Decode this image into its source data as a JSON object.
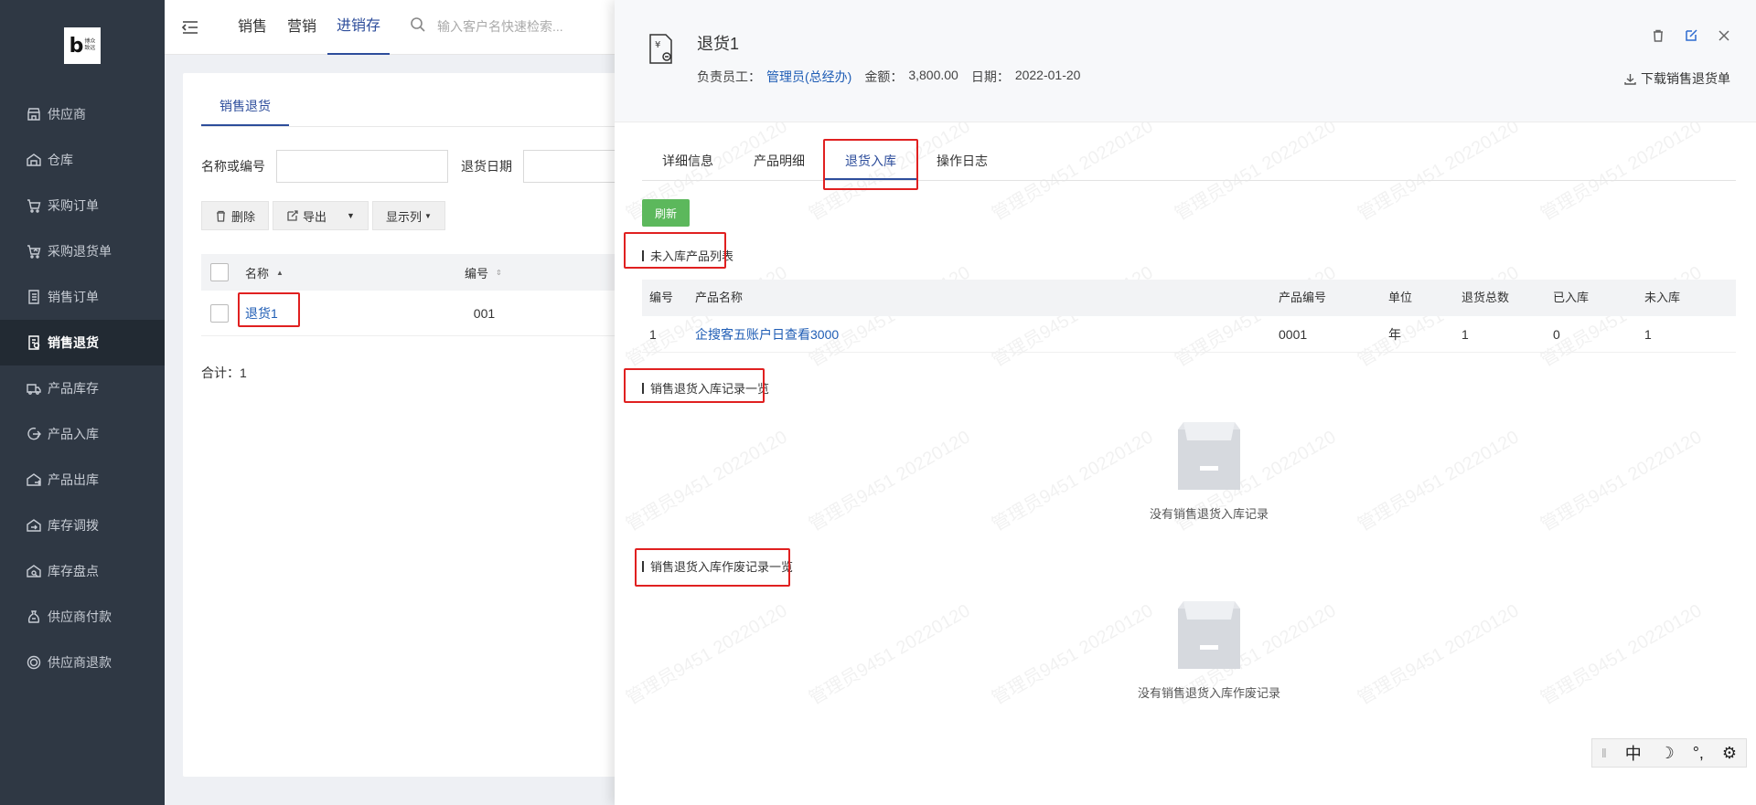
{
  "sidebar": {
    "logo": {
      "mark": "b",
      "text_line1": "博众",
      "text_line2": "致远"
    },
    "items": [
      {
        "label": "供应商",
        "icon": "store-icon",
        "active": false
      },
      {
        "label": "仓库",
        "icon": "warehouse-icon",
        "active": false
      },
      {
        "label": "采购订单",
        "icon": "cart-icon",
        "active": false
      },
      {
        "label": "采购退货单",
        "icon": "cart-return-icon",
        "active": false
      },
      {
        "label": "销售订单",
        "icon": "list-doc-icon",
        "active": false
      },
      {
        "label": "销售退货",
        "icon": "return-doc-icon",
        "active": true
      },
      {
        "label": "产品库存",
        "icon": "truck-icon",
        "active": false
      },
      {
        "label": "产品入库",
        "icon": "inbound-icon",
        "active": false
      },
      {
        "label": "产品出库",
        "icon": "outbound-icon",
        "active": false
      },
      {
        "label": "库存调拨",
        "icon": "transfer-icon",
        "active": false
      },
      {
        "label": "库存盘点",
        "icon": "inventory-check-icon",
        "active": false
      },
      {
        "label": "供应商付款",
        "icon": "money-bag-icon",
        "active": false
      },
      {
        "label": "供应商退款",
        "icon": "refund-icon",
        "active": false
      }
    ]
  },
  "topbar": {
    "tabs": [
      {
        "label": "销售",
        "active": false
      },
      {
        "label": "营销",
        "active": false
      },
      {
        "label": "进销存",
        "active": true
      }
    ],
    "search_placeholder": "输入客户名快速检索..."
  },
  "list": {
    "sub_tab": "销售退货",
    "filter_name_label": "名称或编号",
    "filter_date_label": "退货日期",
    "toolbar": {
      "delete": "删除",
      "export": "导出",
      "columns": "显示列"
    },
    "columns": {
      "name": "名称",
      "code": "编号"
    },
    "rows": [
      {
        "name": "退货1",
        "code": "001"
      }
    ],
    "total": "合计：1"
  },
  "drawer": {
    "title": "退货1",
    "meta": {
      "owner_label": "负责员工：",
      "owner_value": "管理员(总经办)",
      "amount_label": "金额：",
      "amount_value": "3,800.00",
      "date_label": "日期：",
      "date_value": "2022-01-20"
    },
    "download_label": "下载销售退货单",
    "tabs": [
      {
        "label": "详细信息",
        "active": false
      },
      {
        "label": "产品明细",
        "active": false
      },
      {
        "label": "退货入库",
        "active": true
      },
      {
        "label": "操作日志",
        "active": false
      }
    ],
    "refresh_label": "刷新",
    "section_pending": "未入库产品列表",
    "product_columns": {
      "no": "编号",
      "name": "产品名称",
      "code": "产品编号",
      "unit": "单位",
      "return_total": "退货总数",
      "received": "已入库",
      "pending": "未入库"
    },
    "products": [
      {
        "no": "1",
        "name": "企搜客五账户日查看3000",
        "code": "0001",
        "unit": "年",
        "return_total": "1",
        "received": "0",
        "pending": "1"
      }
    ],
    "section_records": "销售退货入库记录一览",
    "records_empty": "没有销售退货入库记录",
    "section_voided": "销售退货入库作废记录一览",
    "voided_empty": "没有销售退货入库作废记录",
    "watermark": "管理员9451 20220120"
  },
  "ime": {
    "mode": "中",
    "moon": "☽",
    "punct": "°,",
    "gear": "⚙"
  },
  "colors": {
    "sidebar_bg": "#2f3844",
    "accent": "#2d4d9b",
    "link": "#1f5db5",
    "refresh_green": "#5cb85c",
    "highlight_red": "#e02020"
  }
}
